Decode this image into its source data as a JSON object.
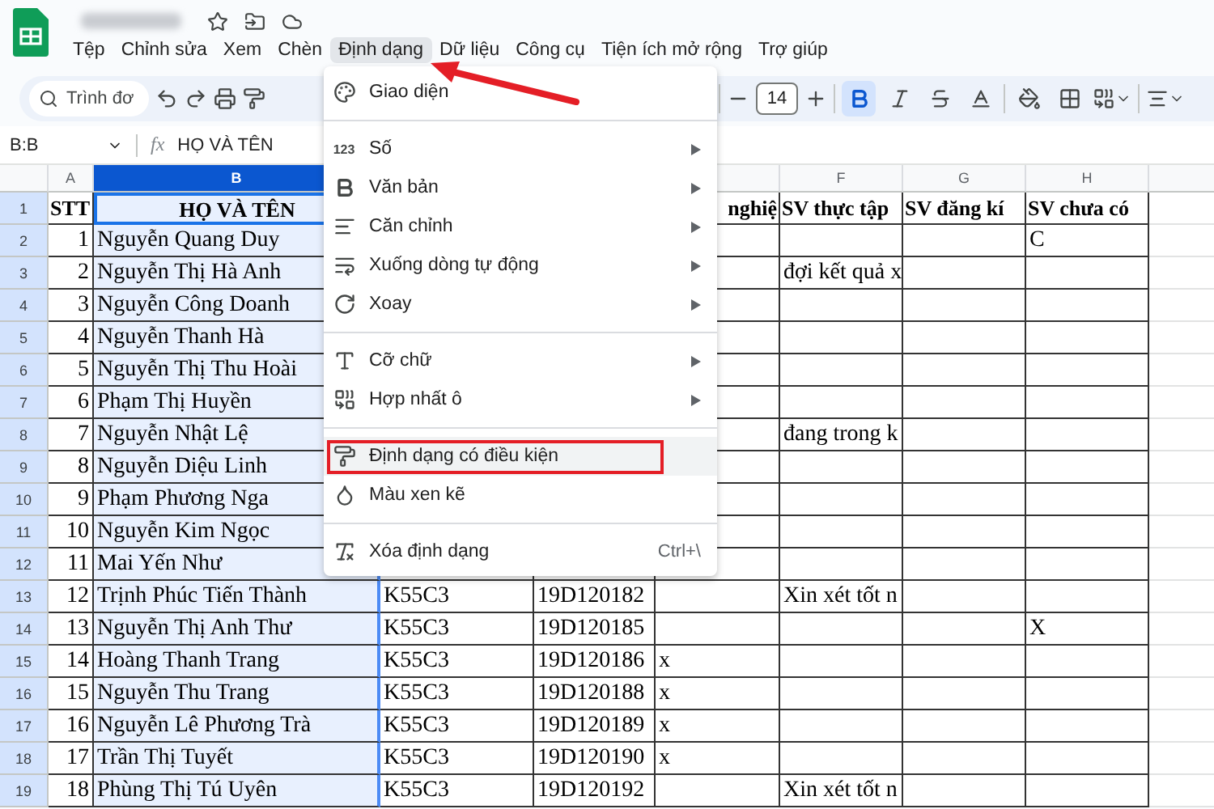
{
  "menu_bar": [
    {
      "label": "Tệp",
      "selected": false
    },
    {
      "label": "Chỉnh sửa",
      "selected": false
    },
    {
      "label": "Xem",
      "selected": false
    },
    {
      "label": "Chèn",
      "selected": false
    },
    {
      "label": "Định dạng",
      "selected": true
    },
    {
      "label": "Dữ liệu",
      "selected": false
    },
    {
      "label": "Công cụ",
      "selected": false
    },
    {
      "label": "Tiện ích mở rộng",
      "selected": false
    },
    {
      "label": "Trợ giúp",
      "selected": false
    }
  ],
  "toolbar": {
    "search_placeholder": "Trình đơ",
    "font_size": "14",
    "buttons": [
      {
        "kind": "bold",
        "selected": true
      },
      {
        "kind": "italic",
        "selected": false
      },
      {
        "kind": "strikethrough",
        "selected": false
      },
      {
        "kind": "text-color",
        "selected": false
      },
      {
        "kind": "fill",
        "selected": false
      },
      {
        "kind": "borders",
        "selected": false
      },
      {
        "kind": "merge",
        "selected": false
      },
      {
        "kind": "align",
        "selected": false
      }
    ]
  },
  "formula_bar": {
    "cell_ref": "B:B",
    "function_label": "fx",
    "content": "HỌ VÀ TÊN"
  },
  "sheet": {
    "columns": [
      {
        "label": "A",
        "selected": false
      },
      {
        "label": "B",
        "selected": true
      },
      {},
      {},
      {},
      {
        "label": "F",
        "selected": false
      },
      {
        "label": "G",
        "selected": false
      },
      {
        "label": "H",
        "selected": false
      }
    ],
    "rows": [
      {
        "label": "1",
        "kind": "header",
        "cells": {
          "A": "STT",
          "B": "HỌ VÀ TÊN",
          "E": "nghiệ",
          "F": "SV thực tập",
          "G": "SV đăng kí",
          "H": "SV chưa có"
        }
      },
      {
        "label": "2",
        "kind": "data",
        "cells": {
          "A": "1",
          "B": "Nguyễn Quang Duy",
          "H": "C"
        }
      },
      {
        "label": "3",
        "kind": "data",
        "cells": {
          "A": "2",
          "B": "Nguyễn Thị Hà Anh",
          "F": "đợi kết quả x"
        }
      },
      {
        "label": "4",
        "kind": "data",
        "cells": {
          "A": "3",
          "B": "Nguyễn Công Doanh"
        }
      },
      {
        "label": "5",
        "kind": "data",
        "cells": {
          "A": "4",
          "B": "Nguyễn Thanh Hà"
        }
      },
      {
        "label": "6",
        "kind": "data",
        "cells": {
          "A": "5",
          "B": "Nguyễn Thị Thu Hoài"
        }
      },
      {
        "label": "7",
        "kind": "data",
        "cells": {
          "A": "6",
          "B": "Phạm Thị Huyền"
        }
      },
      {
        "label": "8",
        "kind": "data",
        "cells": {
          "A": "7",
          "B": "Nguyễn Nhật Lệ",
          "F": "đang trong k"
        }
      },
      {
        "label": "9",
        "kind": "data",
        "cells": {
          "A": "8",
          "B": "Nguyễn Diệu Linh"
        }
      },
      {
        "label": "10",
        "kind": "data",
        "cells": {
          "A": "9",
          "B": "Phạm Phương Nga"
        }
      },
      {
        "label": "11",
        "kind": "data",
        "cells": {
          "A": "10",
          "B": "Nguyễn Kim Ngọc"
        }
      },
      {
        "label": "12",
        "kind": "data",
        "cells": {
          "A": "11",
          "B": "Mai Yến Như"
        }
      },
      {
        "label": "13",
        "kind": "data",
        "cells": {
          "A": "12",
          "B": "Trịnh Phúc Tiến Thành",
          "C": "K55C3",
          "D": "19D120182",
          "F": "Xin xét tốt n"
        }
      },
      {
        "label": "14",
        "kind": "data",
        "cells": {
          "A": "13",
          "B": "Nguyễn Thị Anh Thư",
          "C": "K55C3",
          "D": "19D120185",
          "H": "X"
        }
      },
      {
        "label": "15",
        "kind": "data",
        "cells": {
          "A": "14",
          "B": "Hoàng Thanh Trang",
          "C": "K55C3",
          "D": "19D120186",
          "E": "x"
        }
      },
      {
        "label": "16",
        "kind": "data",
        "cells": {
          "A": "15",
          "B": "Nguyễn Thu Trang",
          "C": "K55C3",
          "D": "19D120188",
          "E": "x"
        }
      },
      {
        "label": "17",
        "kind": "data",
        "cells": {
          "A": "16",
          "B": "Nguyễn Lê Phương Trà",
          "C": "K55C3",
          "D": "19D120189",
          "E": "x"
        }
      },
      {
        "label": "18",
        "kind": "data",
        "cells": {
          "A": "17",
          "B": "Trần Thị Tuyết",
          "C": "K55C3",
          "D": "19D120190",
          "E": "x"
        }
      },
      {
        "label": "19",
        "kind": "data",
        "cells": {
          "A": "18",
          "B": "Phùng Thị Tú Uyên",
          "C": "K55C3",
          "D": "19D120192",
          "F": "Xin xét tốt n"
        }
      }
    ]
  },
  "format_menu": {
    "sections": [
      [
        {
          "kind": "palette",
          "label": "Giao diện",
          "submenu": false,
          "selected": false
        }
      ],
      [
        {
          "kind": "number",
          "glyph": "123",
          "label": "Số",
          "submenu": true,
          "selected": false
        },
        {
          "kind": "text",
          "label": "Văn bản",
          "submenu": true,
          "selected": false
        },
        {
          "kind": "align",
          "label": "Căn chỉnh",
          "submenu": true,
          "selected": false
        },
        {
          "kind": "wrap",
          "label": "Xuống dòng tự động",
          "submenu": true,
          "selected": false
        },
        {
          "kind": "rotate",
          "label": "Xoay",
          "submenu": true,
          "selected": false
        }
      ],
      [
        {
          "kind": "font-size",
          "label": "Cỡ chữ",
          "submenu": true,
          "selected": false
        },
        {
          "kind": "merge",
          "label": "Hợp nhất ô",
          "submenu": true,
          "selected": false
        }
      ],
      [
        {
          "kind": "conditional",
          "label": "Định dạng có điều kiện",
          "submenu": false,
          "selected": true
        },
        {
          "kind": "alternating",
          "label": "Màu xen kẽ",
          "submenu": false,
          "selected": false
        }
      ],
      [
        {
          "kind": "clear",
          "label": "Xóa định dạng",
          "shortcut": "Ctrl+\\",
          "submenu": false,
          "selected": false
        }
      ]
    ]
  }
}
